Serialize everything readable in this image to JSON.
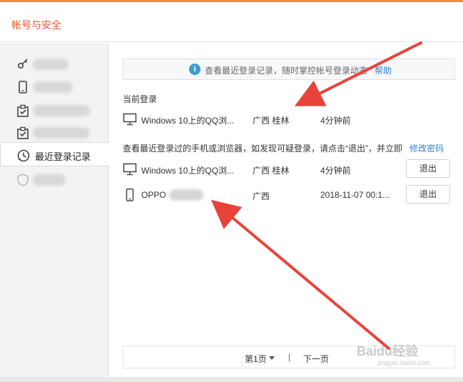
{
  "window": {
    "title": "帐号与安全"
  },
  "sidebar": {
    "items": [
      {
        "icon": "key-icon",
        "label": ""
      },
      {
        "icon": "phone-icon",
        "label": ""
      },
      {
        "icon": "clipboard-check-icon",
        "label": ""
      },
      {
        "icon": "clipboard-check-icon",
        "label": ""
      },
      {
        "icon": "history-clock-icon",
        "label": "最近登录记录"
      },
      {
        "icon": "shield-icon",
        "label": ""
      }
    ]
  },
  "banner": {
    "text": "查看最近登录记录，随时掌控帐号登录动态",
    "help": "帮助"
  },
  "current_login": {
    "title": "当前登录",
    "row": {
      "device": "Windows 10上的QQ浏...",
      "location": "广西 桂林",
      "time": "4分钟前"
    }
  },
  "recent_logins": {
    "title": "查看最近登录过的手机或浏览器，如发现可疑登录，请点击“退出”，并立即",
    "change_password": "修改密码",
    "rows": [
      {
        "device": "Windows 10上的QQ浏...",
        "location": "广西 桂林",
        "time": "4分钟前",
        "action": "退出"
      },
      {
        "device": "OPPO",
        "location": "广西",
        "time": "2018-11-07 00:1...",
        "action": "退出"
      }
    ]
  },
  "pager": {
    "page": "第1页",
    "sep": "|",
    "next": "下一页"
  },
  "watermark": {
    "text": "Baidu经验",
    "url": "jingyan.baidu.com"
  },
  "colors": {
    "accent": "#f08a3c",
    "title": "#e2592c",
    "link": "#2f7fd6",
    "arrow": "#e8433a"
  }
}
